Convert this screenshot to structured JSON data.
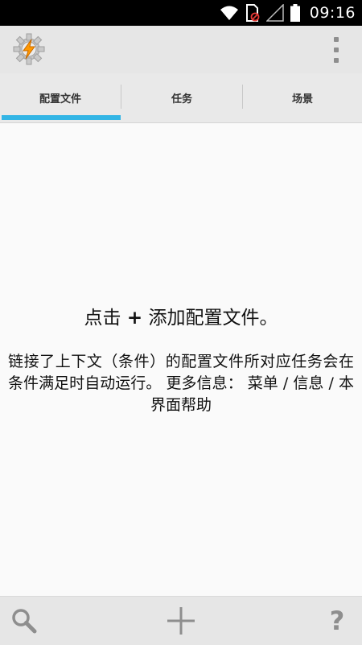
{
  "status_bar": {
    "time": "09:16",
    "icons": [
      "wifi-icon",
      "sim-blocked-icon",
      "signal-icon",
      "battery-icon"
    ]
  },
  "action_bar": {
    "logo_icon": "tasker-gear-bolt-icon",
    "menu_icon": "overflow-menu-icon"
  },
  "tabs": [
    {
      "label": "配置文件",
      "active": true
    },
    {
      "label": "任务",
      "active": false
    },
    {
      "label": "场景",
      "active": false
    }
  ],
  "main": {
    "headline_prefix": "点击",
    "headline_plus": "+",
    "headline_suffix": "添加配置文件。",
    "description": "链接了上下文（条件）的配置文件所对应任务会在条件满足时自动运行。 更多信息： 菜单 / 信息 / 本界面帮助"
  },
  "bottom_bar": {
    "buttons": [
      "search-icon",
      "add-icon",
      "help-icon"
    ],
    "help_glyph": "?"
  },
  "colors": {
    "tab_indicator": "#33b5e5",
    "status_bar": "#000000",
    "bars": "#e6e6e6",
    "icon_gray": "#8e8e8e"
  }
}
